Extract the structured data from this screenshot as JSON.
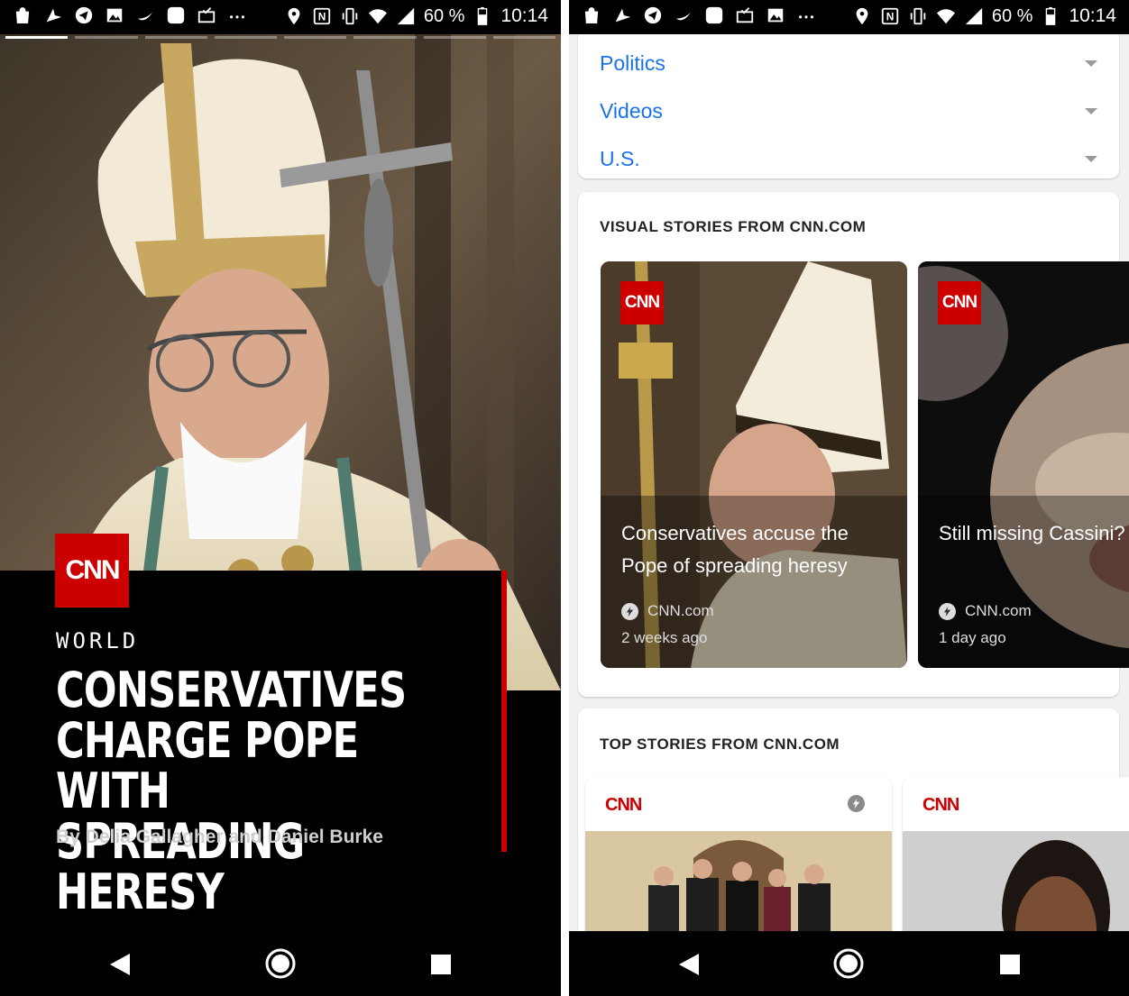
{
  "status_bar": {
    "battery_percent": "60 %",
    "time": "10:14",
    "left_icons": [
      "shopping-bag-icon",
      "navigation-icon",
      "telegram-icon",
      "image-icon",
      "night-icon",
      "app-icon",
      "mail-check-icon",
      "more-icon"
    ],
    "right_icons": [
      "location-icon",
      "nfc-icon",
      "vibrate-icon",
      "wifi-icon",
      "signal-icon",
      "battery-icon"
    ]
  },
  "story": {
    "progress_segments": 8,
    "active_segment": 0,
    "source_logo": "CNN",
    "section": "WORLD",
    "headline": "CONSERVATIVES CHARGE POPE WITH SPREADING HERESY",
    "byline": "By Delia Gallagher and Daniel Burke"
  },
  "feed": {
    "topics": [
      {
        "label": "Politics"
      },
      {
        "label": "Videos"
      },
      {
        "label": "U.S."
      }
    ],
    "visual_stories": {
      "heading": "VISUAL STORIES FROM CNN.COM",
      "items": [
        {
          "logo": "CNN",
          "title": "Conservatives accuse the Pope of spreading heresy",
          "source": "CNN.com",
          "time": "2 weeks ago"
        },
        {
          "logo": "CNN",
          "title": "Still missing Cassini? Here's what else is out there",
          "source": "CNN.com",
          "time": "1 day ago"
        }
      ]
    },
    "top_stories": {
      "heading": "TOP STORIES FROM CNN.COM",
      "items": [
        {
          "logo": "CNN"
        },
        {
          "logo": "CNN"
        }
      ]
    }
  },
  "colors": {
    "cnn_red": "#cc0000",
    "link_blue": "#1a73e8",
    "feed_bg": "#f1f1f1"
  }
}
